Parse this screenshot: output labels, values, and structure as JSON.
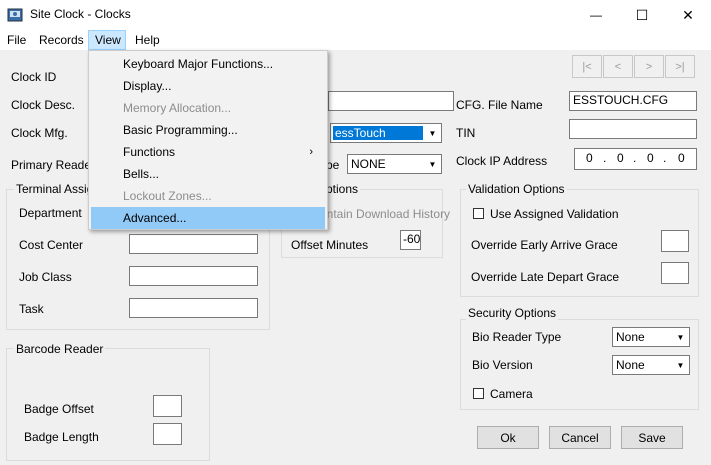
{
  "window": {
    "title": "Site Clock - Clocks",
    "minimize_glyph": "—",
    "maximize_glyph": "☐",
    "close_glyph": "✕"
  },
  "menubar": {
    "file": "File",
    "records": "Records",
    "view": "View",
    "help": "Help"
  },
  "view_menu": {
    "items": [
      {
        "label": "Keyboard Major Functions...",
        "disabled": false
      },
      {
        "label": "Display...",
        "disabled": false
      },
      {
        "label": "Memory Allocation...",
        "disabled": true
      },
      {
        "label": "Basic Programming...",
        "disabled": false
      },
      {
        "label": "Functions",
        "disabled": false,
        "submenu": true
      },
      {
        "label": "Bells...",
        "disabled": false
      },
      {
        "label": "Lockout Zones...",
        "disabled": true
      },
      {
        "label": "Advanced...",
        "disabled": false,
        "highlighted": true
      }
    ],
    "submenu_arrow": "›"
  },
  "nav": {
    "first": "|<",
    "prev": "<",
    "next": ">",
    "last": ">|"
  },
  "form": {
    "clock_id_label": "Clock ID",
    "clock_desc_label": "Clock Desc.",
    "clock_mfg_label": "Clock Mfg.",
    "clock_mfg_value": "essTouch",
    "primary_reader_label": "Primary Reader T",
    "type_label": "pe",
    "type_value": "NONE",
    "cfg_file_label": "CFG. File Name",
    "cfg_file_value": "ESSTOUCH.CFG",
    "tin_label": "TIN",
    "tin_value": "",
    "clock_ip_label": "Clock IP Address",
    "ip": [
      "0",
      "0",
      "0",
      "0"
    ]
  },
  "terminal_assign": {
    "title": "Terminal Assign",
    "department": "Department",
    "cost_center": "Cost Center",
    "job_class": "Job Class",
    "task": "Task"
  },
  "options": {
    "title": "ptions",
    "maintain_download": "intain Download History",
    "offset_minutes_label": "Offset Minutes",
    "offset_minutes_value": "-60"
  },
  "validation": {
    "title": "Validation Options",
    "use_assigned": "Use Assigned Validation",
    "early_arrive": "Override Early Arrive Grace",
    "late_depart": "Override Late Depart Grace"
  },
  "security": {
    "title": "Security Options",
    "bio_reader_label": "Bio Reader Type",
    "bio_reader_value": "None",
    "bio_version_label": "Bio Version",
    "bio_version_value": "None",
    "camera": "Camera"
  },
  "barcode": {
    "title": "Barcode Reader",
    "badge_offset": "Badge Offset",
    "badge_length": "Badge Length"
  },
  "buttons": {
    "ok": "Ok",
    "cancel": "Cancel",
    "save": "Save"
  },
  "colors": {
    "menu_highlight": "#91c9f7",
    "menu_active": "#cce8ff",
    "accent": "#0078d7"
  }
}
